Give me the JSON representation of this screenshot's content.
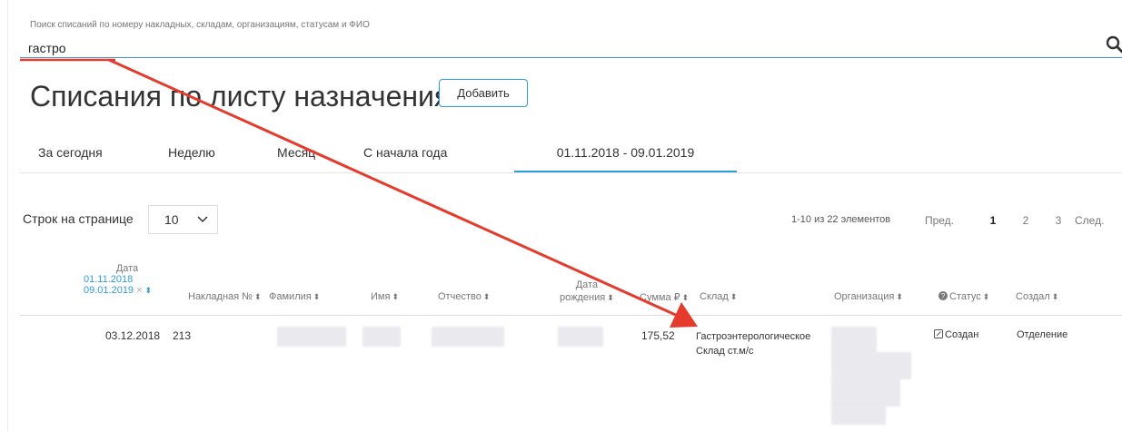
{
  "search": {
    "hint": "Поиск списаний по номеру накладных, складам, организациям, статусам и ФИО",
    "value": "гастро"
  },
  "page": {
    "title": "Списания по листу назначения",
    "add_button": "Добавить"
  },
  "tabs": [
    {
      "label": "За сегодня",
      "active": false
    },
    {
      "label": "Неделю",
      "active": false
    },
    {
      "label": "Месяц",
      "active": false
    },
    {
      "label": "С начала года",
      "active": false
    },
    {
      "label": "01.11.2018 - 09.01.2019",
      "active": true
    }
  ],
  "rows_per_page": {
    "label": "Строк на странице",
    "value": "10"
  },
  "pagination": {
    "info": "1-10 из 22 элементов",
    "prev": "Пред.",
    "pages": [
      "1",
      "2",
      "3"
    ],
    "current": "1",
    "next": "След."
  },
  "table": {
    "date_header": {
      "label": "Дата",
      "range_from": "01.11.2018",
      "range_to": "09.01.2019",
      "clear": "×"
    },
    "columns": {
      "invoice": "Накладная №",
      "last_name": "Фамилия",
      "first_name": "Имя",
      "patronymic": "Отчество",
      "birth_line1": "Дата",
      "birth_line2": "рождения",
      "sum": "Сумма ₽",
      "warehouse": "Склад",
      "organization": "Организация",
      "status": "Статус",
      "created_by": "Создал"
    },
    "sort_glyph": "⬍",
    "rows": [
      {
        "date": "03.12.2018",
        "invoice": "213",
        "sum": "175,52",
        "warehouse_line1": "Гастроэнтерологическое",
        "warehouse_line2": "Склад ст.м/с",
        "status": "Создан",
        "created_by": "Отделение"
      }
    ]
  },
  "annotation": {
    "color": "#e53b2c"
  }
}
